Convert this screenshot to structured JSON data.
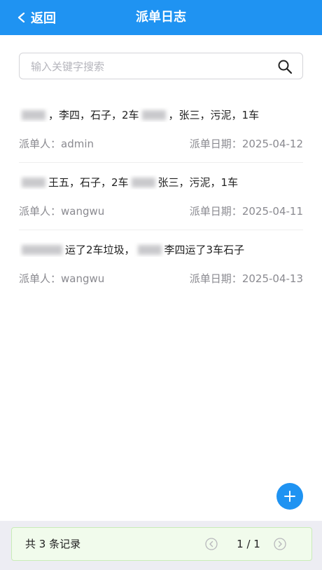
{
  "header": {
    "back_label": "返回",
    "title": "派单日志",
    "color": "#1f93f2"
  },
  "search": {
    "placeholder": "输入关键字搜索",
    "value": "",
    "icon": "search-icon"
  },
  "logs": [
    {
      "description": [
        "，李四，石子，2车",
        "，张三，污泥，1车"
      ],
      "dispatcher_label": "派单人：",
      "dispatcher": "admin",
      "date_label": "派单日期：",
      "date": "2025-04-12"
    },
    {
      "description": [
        "王五，石子，2车",
        "张三，污泥，1车"
      ],
      "dispatcher_label": "派单人：",
      "dispatcher": "wangwu",
      "date_label": "派单日期：",
      "date": "2025-04-11"
    },
    {
      "description": [
        "运了2车垃圾，",
        "李四运了3车石子"
      ],
      "dispatcher_label": "派单人：",
      "dispatcher": "wangwu",
      "date_label": "派单日期：",
      "date": "2025-04-13"
    }
  ],
  "fab": {
    "icon": "plus-icon"
  },
  "footer": {
    "total_text": "共 3 条记录",
    "page_info": "1 / 1",
    "accent": "#c9ecb8"
  }
}
